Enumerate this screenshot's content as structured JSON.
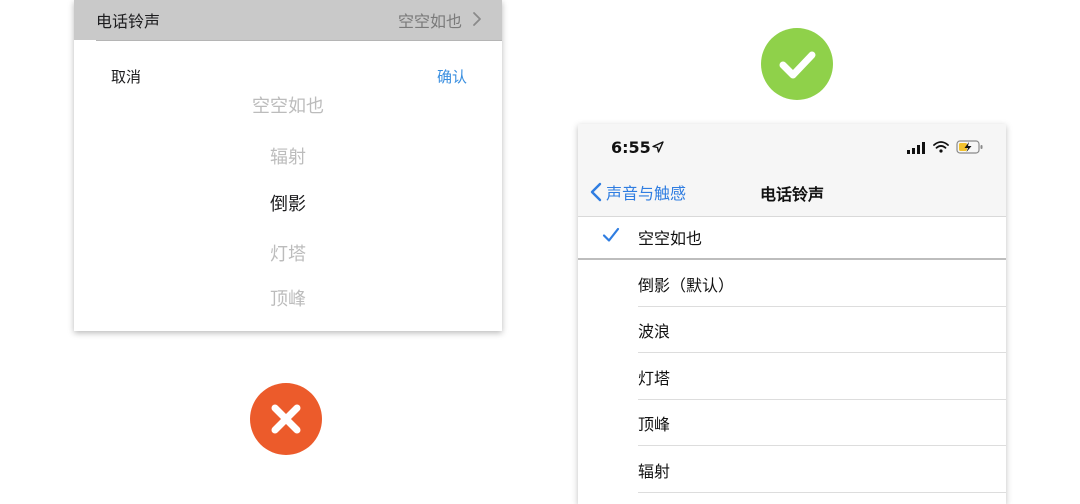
{
  "left_mockup": {
    "row": {
      "label": "电话铃声",
      "value": "空空如也"
    },
    "actions": {
      "cancel": "取消",
      "confirm": "确认"
    },
    "picker": [
      "空空如也",
      "辐射",
      "倒影",
      "灯塔",
      "顶峰"
    ],
    "picker_selected_index": 2
  },
  "right_mockup": {
    "status_bar": {
      "time": "6:55"
    },
    "nav": {
      "back_label": "声音与触感",
      "title": "电话铃声"
    },
    "selected_tone": "空空如也",
    "tones": [
      "倒影（默认）",
      "波浪",
      "灯塔",
      "顶峰",
      "辐射"
    ]
  },
  "colors": {
    "wrong": "#ec5b2b",
    "right": "#8fd14a",
    "ios_blue": "#2f7de1",
    "picker_blue": "#3a8fe0"
  },
  "icons": {
    "wrong_badge": "close-icon",
    "right_badge": "checkmark-icon",
    "row_chevron": "chevron-right-icon",
    "back": "chevron-left-icon",
    "selected_mark": "checkmark-icon"
  }
}
